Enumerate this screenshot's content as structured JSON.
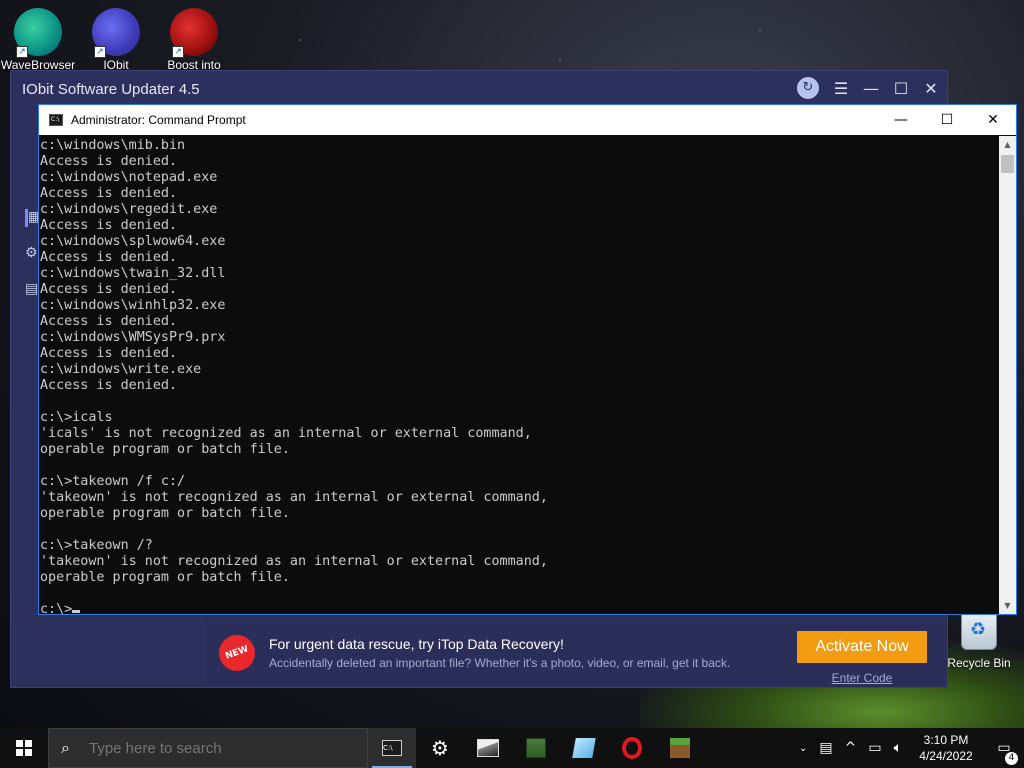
{
  "desktop": {
    "icons": [
      {
        "label": "WaveBrowser",
        "icon": "wavebrowser-icon"
      },
      {
        "label": "IObit",
        "icon": "iobit-icon"
      },
      {
        "label": "Boost into",
        "icon": "boost-icon"
      }
    ],
    "recycle_bin": {
      "label": "Recycle Bin"
    }
  },
  "iobit": {
    "title": "IObit Software Updater 4.5",
    "promo": {
      "badge": "NEW",
      "title": "For urgent data rescue, try iTop Data Recovery!",
      "subtitle": "Accidentally deleted an important file? Whether it's a photo, video, or email, get it back.",
      "activate_label": "Activate Now",
      "enter_code_label": "Enter Code"
    }
  },
  "cmd": {
    "title": "Administrator: Command Prompt",
    "lines": [
      "c:\\windows\\mib.bin",
      "Access is denied.",
      "c:\\windows\\notepad.exe",
      "Access is denied.",
      "c:\\windows\\regedit.exe",
      "Access is denied.",
      "c:\\windows\\splwow64.exe",
      "Access is denied.",
      "c:\\windows\\twain_32.dll",
      "Access is denied.",
      "c:\\windows\\winhlp32.exe",
      "Access is denied.",
      "c:\\windows\\WMSysPr9.prx",
      "Access is denied.",
      "c:\\windows\\write.exe",
      "Access is denied.",
      "",
      "c:\\>icals",
      "'icals' is not recognized as an internal or external command,",
      "operable program or batch file.",
      "",
      "c:\\>takeown /f c:/",
      "'takeown' is not recognized as an internal or external command,",
      "operable program or batch file.",
      "",
      "c:\\>takeown /?",
      "'takeown' is not recognized as an internal or external command,",
      "operable program or batch file.",
      ""
    ],
    "prompt": "c:\\>"
  },
  "taskbar": {
    "search_placeholder": "Type here to search",
    "apps": [
      "cmd-icon",
      "settings-gear-icon",
      "photos-icon",
      "minecraft-icon",
      "notepad-icon",
      "opera-icon",
      "minecraft-grass-icon"
    ],
    "clock_time": "3:10 PM",
    "clock_date": "4/24/2022",
    "notifications": "4"
  },
  "colors": {
    "iobit_bg": "#2d2f5c",
    "activate_button": "#f39c12",
    "cmd_text": "#cccccc",
    "cmd_bg": "#0c0c0c"
  }
}
